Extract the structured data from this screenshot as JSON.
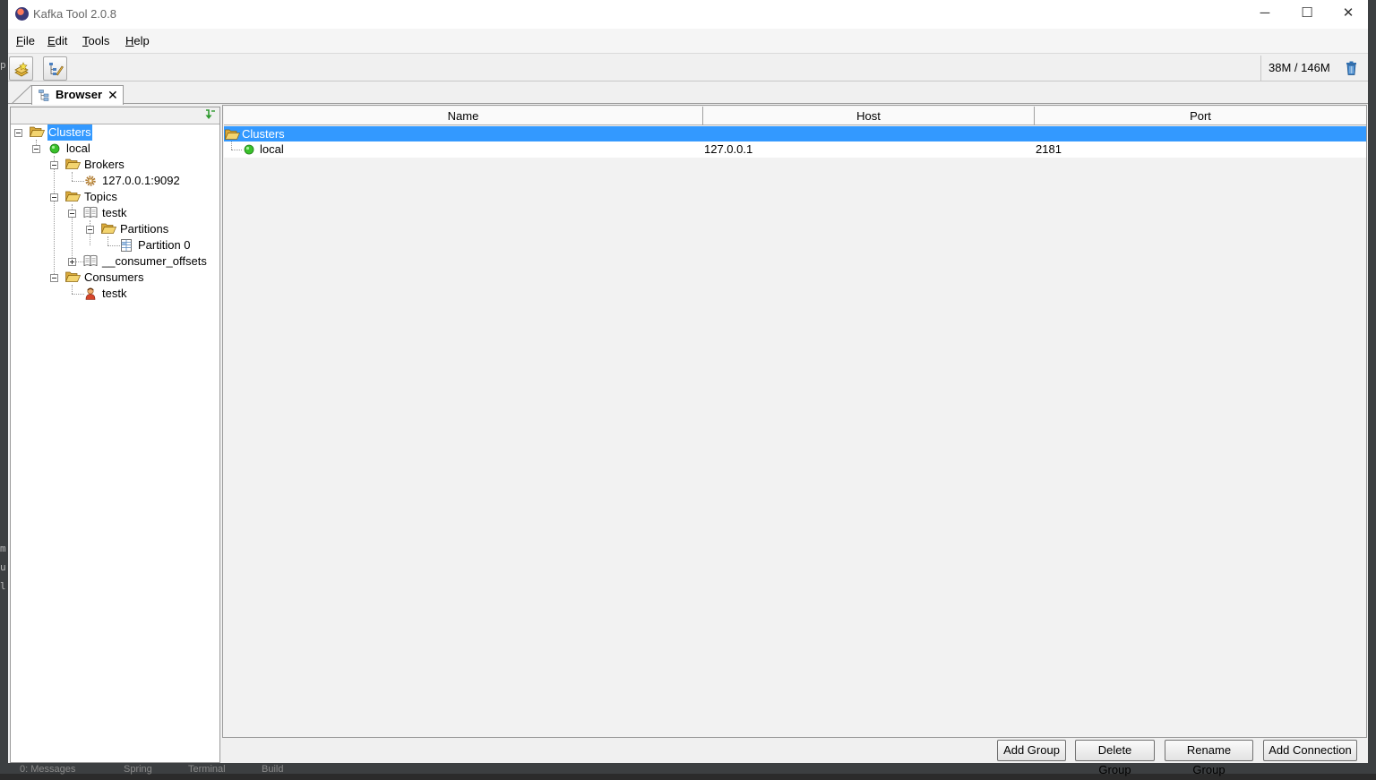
{
  "window": {
    "title": "Kafka Tool  2.0.8",
    "controls": {
      "minimize": "─",
      "maximize": "☐",
      "close": "✕"
    }
  },
  "menu": [
    {
      "key": "F",
      "rest": "ile"
    },
    {
      "key": "E",
      "rest": "dit"
    },
    {
      "key": "T",
      "rest": "ools"
    },
    {
      "key": "H",
      "rest": "elp"
    }
  ],
  "toolbar": {
    "buttons": [
      "add-cluster-icon",
      "edit-tree-icon"
    ],
    "memory": "38M / 146M",
    "gc_icon": "trash-icon"
  },
  "tabs": [
    {
      "label": "Browser",
      "close": "✕",
      "icon": "browser-tree-icon"
    }
  ],
  "tree": {
    "nodes": [
      {
        "label": "Clusters",
        "icon": "folder-open-icon",
        "selected": true
      },
      {
        "label": "local",
        "icon": "green-status-icon"
      },
      {
        "label": "Brokers",
        "icon": "folder-open-icon"
      },
      {
        "label": "127.0.0.1:9092",
        "icon": "broker-gear-icon"
      },
      {
        "label": "Topics",
        "icon": "folder-open-icon"
      },
      {
        "label": "testk",
        "icon": "topic-book-icon"
      },
      {
        "label": "Partitions",
        "icon": "folder-open-icon"
      },
      {
        "label": "Partition 0",
        "icon": "partition-grid-icon"
      },
      {
        "label": "__consumer_offsets",
        "icon": "topic-book-icon"
      },
      {
        "label": "Consumers",
        "icon": "folder-open-icon"
      },
      {
        "label": "testk",
        "icon": "consumer-person-icon"
      }
    ]
  },
  "table": {
    "columns": [
      "Name",
      "Host",
      "Port"
    ],
    "group_row": {
      "name": "Clusters"
    },
    "rows": [
      {
        "name": "local",
        "host": "127.0.0.1",
        "port": "2181"
      }
    ]
  },
  "actions": [
    "Add Group",
    "Delete Group",
    "Rename Group",
    "Add Connection"
  ],
  "background_ide": {
    "bottom_tabs": [
      "0: Messages",
      "Spring",
      "Terminal",
      "Build"
    ],
    "left_glyphs": [
      "p",
      "m",
      "u",
      "l"
    ]
  },
  "colors": {
    "selection": "#3399ff",
    "status_green": "#39c12b",
    "folder": "#e8c35a"
  }
}
